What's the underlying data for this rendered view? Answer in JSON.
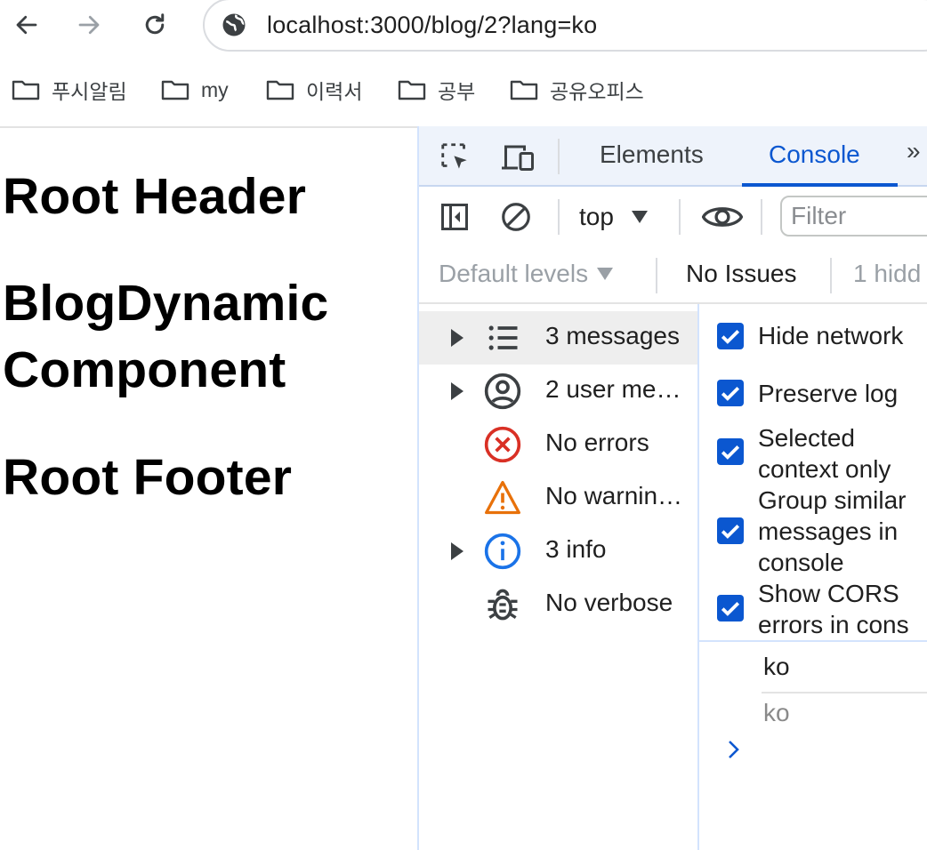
{
  "browser": {
    "url": "localhost:3000/blog/2?lang=ko",
    "bookmarks": [
      {
        "label": "푸시알림"
      },
      {
        "label": "my"
      },
      {
        "label": "이력서"
      },
      {
        "label": "공부"
      },
      {
        "label": "공유오피스"
      }
    ]
  },
  "page": {
    "header": "Root Header",
    "component": "BlogDynamic Component",
    "footer": "Root Footer"
  },
  "devtools": {
    "tabs": [
      {
        "label": "Elements",
        "active": false
      },
      {
        "label": "Console",
        "active": true
      }
    ],
    "more_tabs": "»",
    "context": "top",
    "filter_placeholder": "Filter",
    "levels": "Default levels",
    "issues": "No Issues",
    "hidden": "1 hidd",
    "sidebar": [
      {
        "label": "3 messages",
        "icon": "list-icon",
        "expandable": true,
        "selected": true
      },
      {
        "label": "2 user me…",
        "icon": "user-icon",
        "expandable": true,
        "selected": false
      },
      {
        "label": "No errors",
        "icon": "error-icon",
        "expandable": false,
        "selected": false
      },
      {
        "label": "No warnin…",
        "icon": "warning-icon",
        "expandable": false,
        "selected": false
      },
      {
        "label": "3 info",
        "icon": "info-icon",
        "expandable": true,
        "selected": false
      },
      {
        "label": "No verbose",
        "icon": "bug-icon",
        "expandable": false,
        "selected": false
      }
    ],
    "settings": [
      {
        "label": "Hide network",
        "checked": true
      },
      {
        "label": "Preserve log",
        "checked": true
      },
      {
        "label": "Selected\ncontext only",
        "checked": true
      },
      {
        "label": "Group similar\nmessages in\nconsole",
        "checked": true
      },
      {
        "label": "Show CORS\nerrors in cons",
        "checked": true
      }
    ],
    "console_messages": [
      "ko",
      "ko"
    ],
    "colors": {
      "accent": "#0b57d0",
      "error": "#d93025",
      "warning": "#e8710a",
      "info": "#1a73e8"
    }
  }
}
